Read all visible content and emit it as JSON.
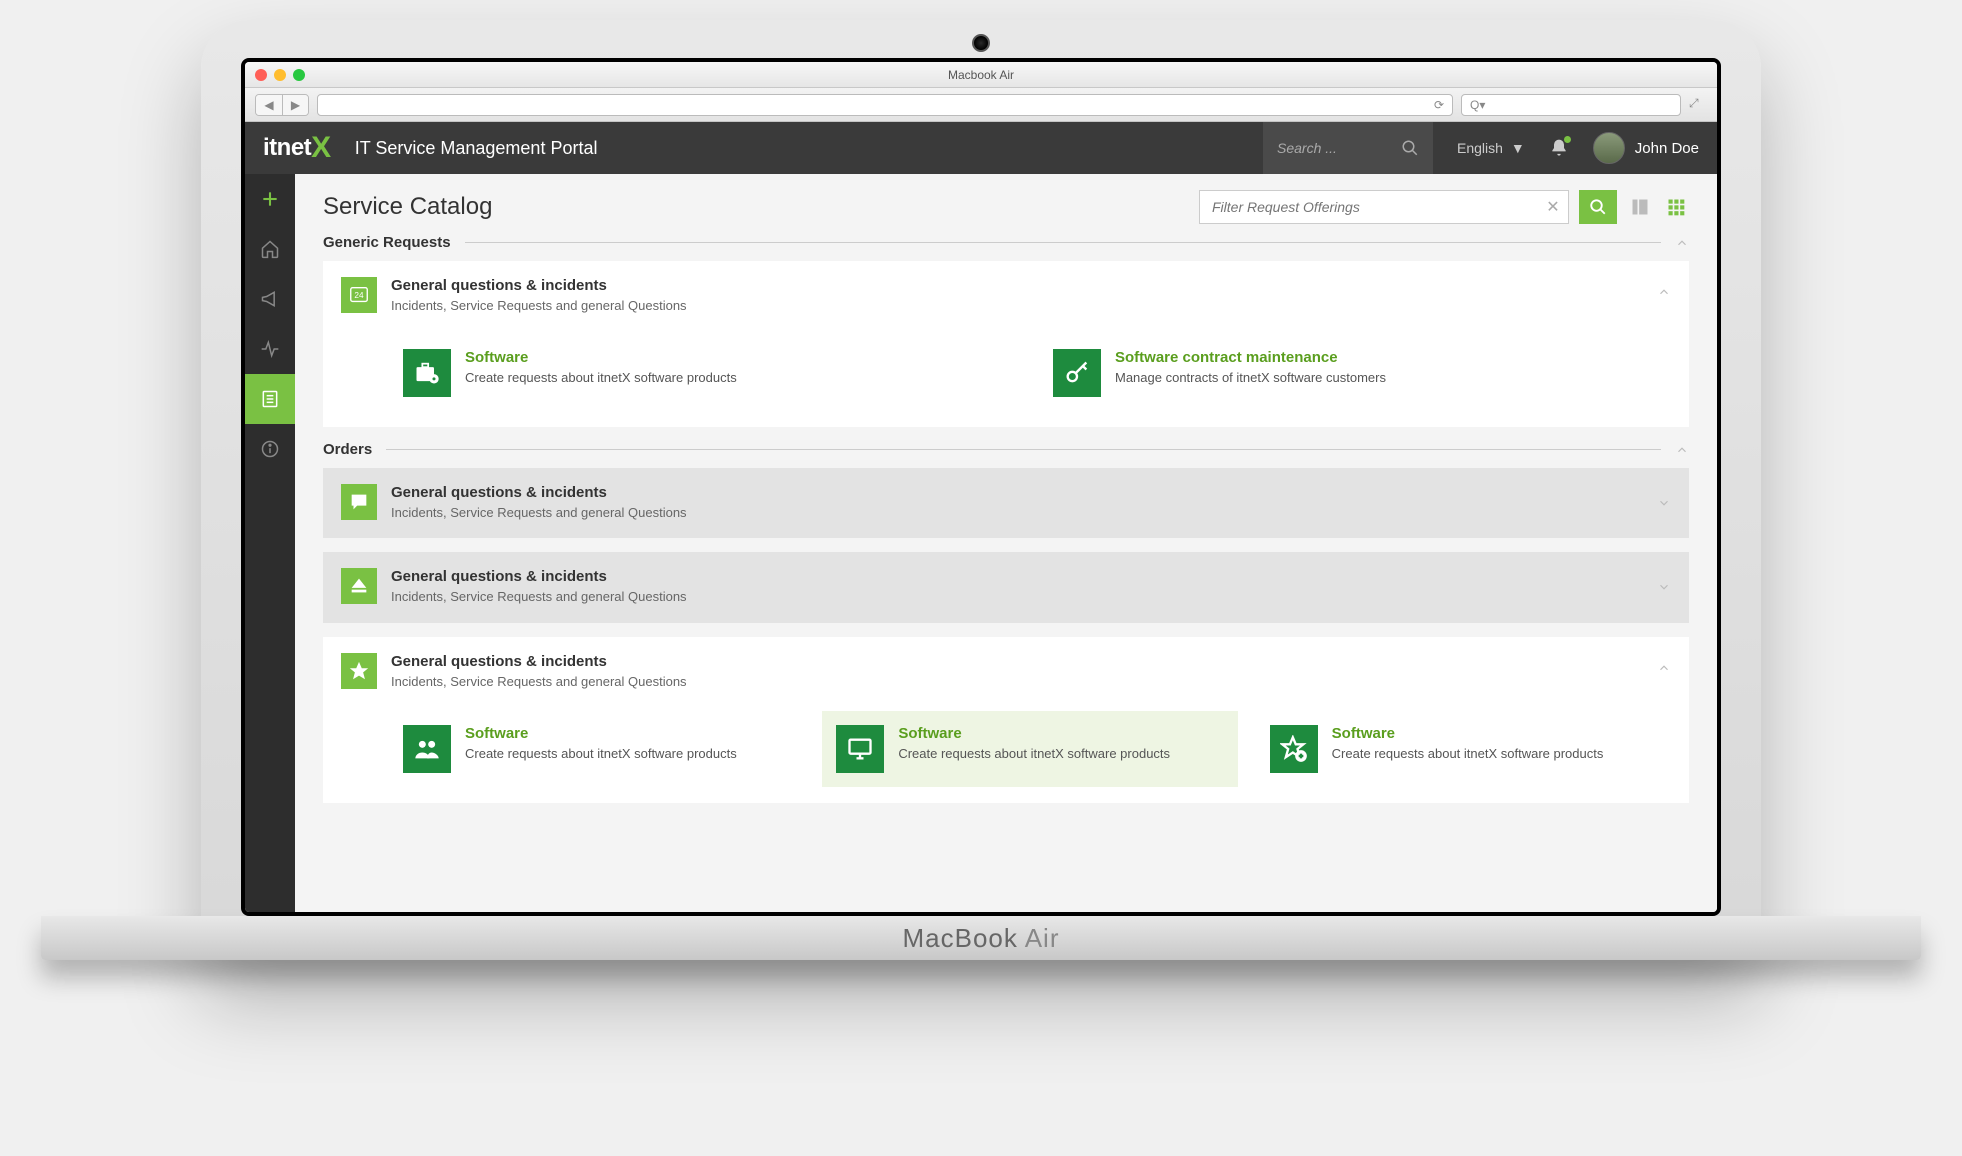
{
  "window": {
    "title": "Macbook Air",
    "search_prefix": "Q"
  },
  "header": {
    "logo_main": "itnet",
    "logo_accent": "X",
    "app_title": "IT Service Management Portal",
    "search_placeholder": "Search ...",
    "language": "English",
    "user_name": "John Doe"
  },
  "page": {
    "title": "Service Catalog",
    "filter_placeholder": "Filter Request Offerings"
  },
  "sections": [
    {
      "title": "Generic Requests",
      "cards": [
        {
          "bg": "white",
          "icon": "support-24-icon",
          "title": "General questions & incidents",
          "desc": "Incidents, Service Requests and general Questions",
          "expanded": true,
          "offerings": [
            {
              "icon": "briefcase-gear-icon",
              "title": "Software",
              "desc": "Create requests about itnetX software products",
              "hover": false
            },
            {
              "icon": "key-icon",
              "title": "Software contract maintenance",
              "desc": "Manage contracts of itnetX software customers",
              "hover": false
            }
          ]
        }
      ]
    },
    {
      "title": "Orders",
      "cards": [
        {
          "bg": "grey",
          "icon": "chat-icon",
          "title": "General questions & incidents",
          "desc": "Incidents, Service Requests and general Questions",
          "expanded": false,
          "offerings": []
        },
        {
          "bg": "grey",
          "icon": "eject-icon",
          "title": "General questions & incidents",
          "desc": "Incidents, Service Requests and general Questions",
          "expanded": false,
          "offerings": []
        },
        {
          "bg": "white",
          "icon": "star-icon",
          "title": "General questions & incidents",
          "desc": "Incidents, Service Requests and general Questions",
          "expanded": true,
          "offerings": [
            {
              "icon": "users-icon",
              "title": "Software",
              "desc": "Create requests about itnetX software products",
              "hover": false
            },
            {
              "icon": "monitor-icon",
              "title": "Software",
              "desc": "Create requests about itnetX software products",
              "hover": true
            },
            {
              "icon": "star-plus-icon",
              "title": "Software",
              "desc": "Create requests about itnetX software products",
              "hover": false
            }
          ]
        }
      ]
    }
  ],
  "laptop_label_bold": "MacBook",
  "laptop_label_light": " Air"
}
